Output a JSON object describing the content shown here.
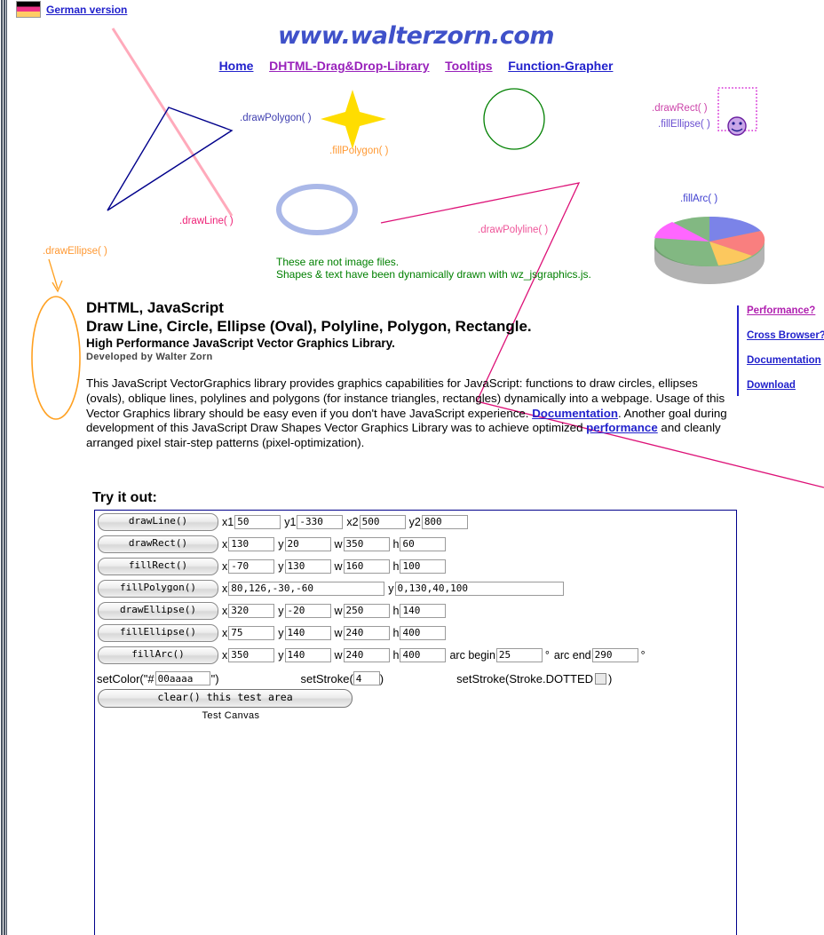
{
  "topbar": {
    "german_link": "German version",
    "flag_icon": "german-flag-icon"
  },
  "logo": "www.walterzorn.com",
  "nav": [
    {
      "label": "Home",
      "color": "#2222cc"
    },
    {
      "label": "DHTML-Drag&Drop-Library",
      "color": "#9922bb"
    },
    {
      "label": "Tooltips",
      "color": "#9922bb"
    },
    {
      "label": "Function-Grapher",
      "color": "#2222cc"
    }
  ],
  "graphics_labels": {
    "draw_polygon": ".drawPolygon( )",
    "fill_polygon": ".fillPolygon( )",
    "draw_line": ".drawLine( )",
    "draw_ellipse": ".drawEllipse( )",
    "draw_polyline": ".drawPolyline( )",
    "draw_rect": ".drawRect( )",
    "fill_ellipse": ".fillEllipse( )",
    "fill_arc": ".fillArc( )",
    "note_line1": "These are not image files.",
    "note_line2": "Shapes & text have been dynamically drawn with wz_jsgraphics.js."
  },
  "graphics_colors": {
    "polygon_outline": "#00008b",
    "line_pink": "#ffaabb",
    "star_yellow": "#ffdd00",
    "circle_green": "#008000",
    "ellipse_blue": "#aab8e8",
    "polyline_magenta": "#dd1177",
    "rect_dotted": "#cc00cc",
    "ellipse_orange": "#ffa020",
    "note_green": "#008000",
    "pie_blue": "#7b83e8",
    "pie_red": "#f97f7f",
    "pie_yellow": "#fcc85e",
    "pie_green": "#82b882",
    "pie_magenta": "#ff66ff",
    "pie_side": "#b3b3b3"
  },
  "headings": {
    "line1": "DHTML, JavaScript",
    "line2": "Draw Line, Circle, Ellipse (Oval), Polyline, Polygon, Rectangle.",
    "line3": "High Performance JavaScript Vector Graphics Library.",
    "line4": "Developed by Walter Zorn"
  },
  "paragraph": {
    "part1": "This JavaScript VectorGraphics library provides graphics capabilities for JavaScript: functions to draw circles, ellipses (ovals), oblique lines, polylines and polygons (for instance triangles, rectangles) dynamically into a webpage. Usage of this Vector Graphics library should be easy even if you don't have JavaScript experience. ",
    "link1": "Documentation",
    "part2": ". Another goal during development of this JavaScript Draw Shapes Vector Graphics Library was to achieve optimized ",
    "link2": "performance",
    "part3": " and cleanly arranged pixel stair-step patterns (pixel-optimization)."
  },
  "right_links": [
    {
      "label": "Performance?",
      "color": "#b020b0"
    },
    {
      "label": "Cross Browser?",
      "color": "#2222cc"
    },
    {
      "label": "Documentation",
      "color": "#2222cc"
    },
    {
      "label": "Download",
      "color": "#2222cc"
    }
  ],
  "tryout": {
    "title": "Try it out:",
    "rows": [
      {
        "button": "drawLine()",
        "fields": [
          {
            "label": "x1",
            "value": "50",
            "size": "num"
          },
          {
            "label": "y1",
            "value": "-330",
            "size": "num"
          },
          {
            "label": "x2",
            "value": "500",
            "size": "num"
          },
          {
            "label": "y2",
            "value": "800",
            "size": "num"
          }
        ]
      },
      {
        "button": "drawRect()",
        "fields": [
          {
            "label": "x",
            "value": "130",
            "size": "num"
          },
          {
            "label": "y",
            "value": "20",
            "size": "num"
          },
          {
            "label": "w",
            "value": "350",
            "size": "num"
          },
          {
            "label": "h",
            "value": "60",
            "size": "num"
          }
        ]
      },
      {
        "button": "fillRect()",
        "fields": [
          {
            "label": "x",
            "value": "-70",
            "size": "num"
          },
          {
            "label": "y",
            "value": "130",
            "size": "num"
          },
          {
            "label": "w",
            "value": "160",
            "size": "num"
          },
          {
            "label": "h",
            "value": "100",
            "size": "num"
          }
        ]
      },
      {
        "button": "fillPolygon()",
        "fields": [
          {
            "label": "x",
            "value": "80,126,-30,-60",
            "size": "wide"
          },
          {
            "label": "y",
            "value": "0,130,40,100",
            "size": "wide2"
          }
        ]
      },
      {
        "button": "drawEllipse()",
        "fields": [
          {
            "label": "x",
            "value": "320",
            "size": "num"
          },
          {
            "label": "y",
            "value": "-20",
            "size": "num"
          },
          {
            "label": "w",
            "value": "250",
            "size": "num"
          },
          {
            "label": "h",
            "value": "140",
            "size": "num"
          }
        ]
      },
      {
        "button": "fillEllipse()",
        "fields": [
          {
            "label": "x",
            "value": "75",
            "size": "num"
          },
          {
            "label": "y",
            "value": "140",
            "size": "num"
          },
          {
            "label": "w",
            "value": "240",
            "size": "num"
          },
          {
            "label": "h",
            "value": "400",
            "size": "num"
          }
        ]
      },
      {
        "button": "fillArc()",
        "fields": [
          {
            "label": "x",
            "value": "350",
            "size": "num"
          },
          {
            "label": "y",
            "value": "140",
            "size": "num"
          },
          {
            "label": "w",
            "value": "240",
            "size": "num"
          },
          {
            "label": "h",
            "value": "400",
            "size": "num"
          },
          {
            "label": "arc begin",
            "value": "25",
            "size": "num",
            "suffix": "°"
          },
          {
            "label": "arc end",
            "value": "290",
            "size": "num",
            "suffix": "°"
          }
        ]
      }
    ],
    "setcolor_prefix": "setColor(\"#",
    "setcolor_value": "00aaaa",
    "setcolor_suffix": "\")",
    "setstroke_prefix": "setStroke(",
    "setstroke_value": "4",
    "setstroke_suffix": ")",
    "setstroke_dotted_prefix": "setStroke(Stroke.DOTTED",
    "setstroke_dotted_suffix": ")",
    "clear_button": "clear() this test area",
    "canvas_label": "Test Canvas"
  }
}
